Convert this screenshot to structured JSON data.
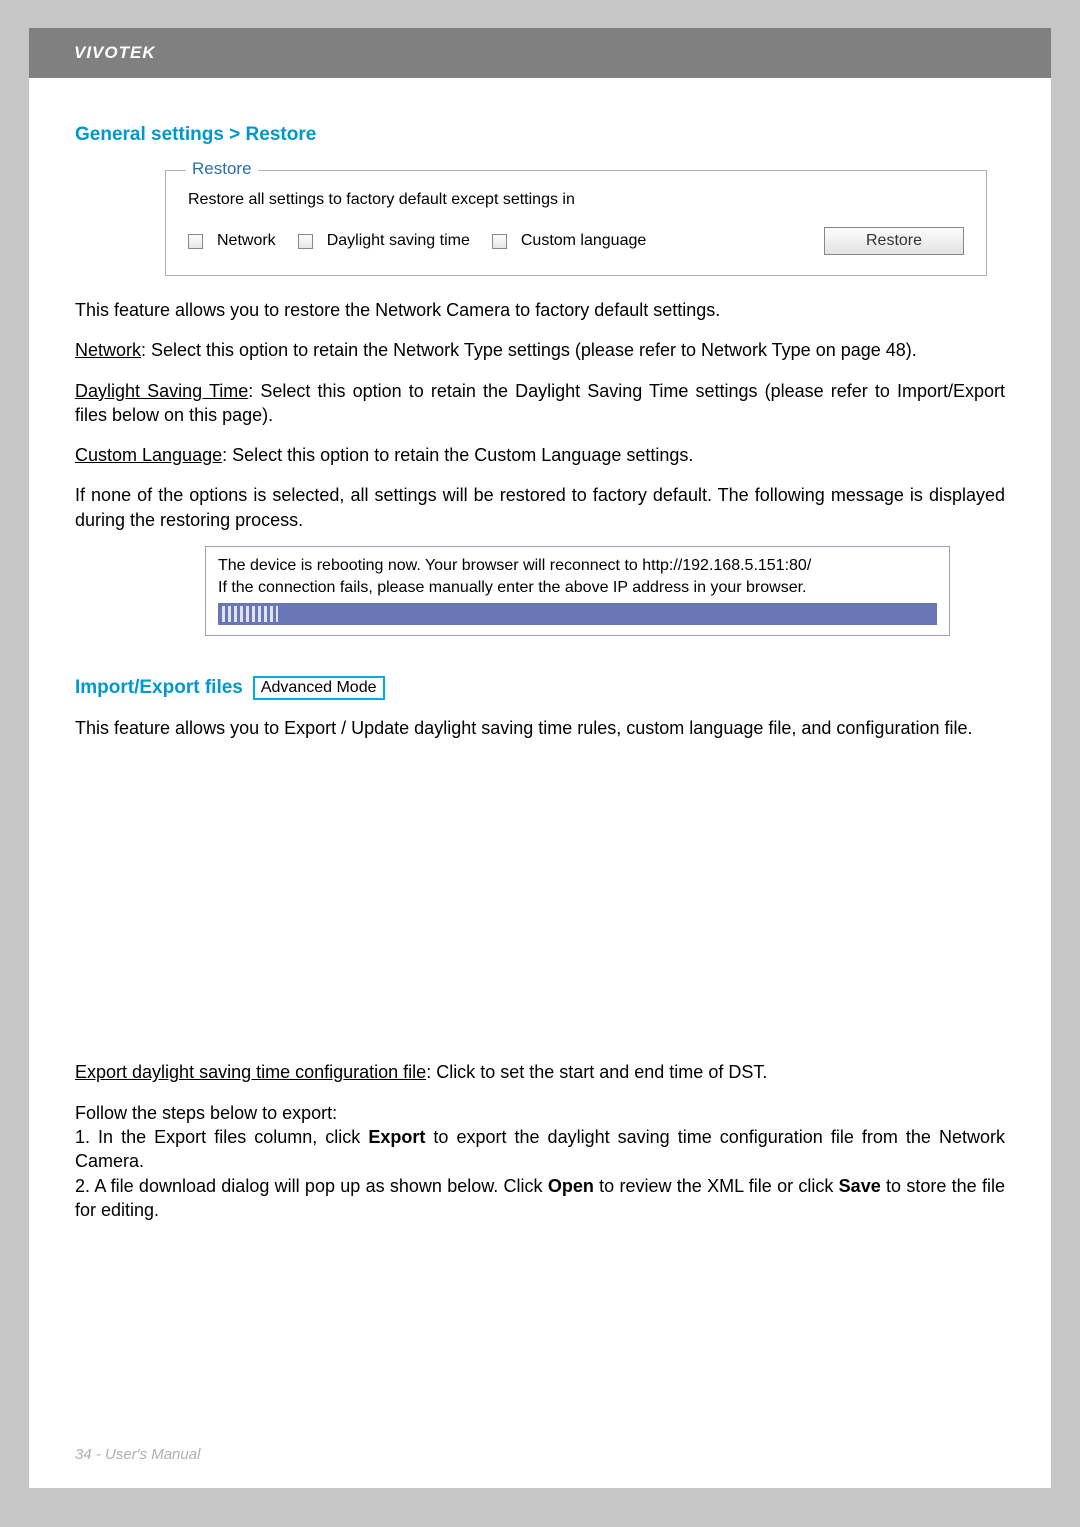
{
  "header": {
    "brand": "VIVOTEK"
  },
  "section1": {
    "title": "General settings > Restore",
    "box": {
      "legend": "Restore",
      "desc": "Restore all settings to factory default except settings in",
      "options": {
        "network": "Network",
        "dst": "Daylight saving time",
        "lang": "Custom language"
      },
      "button": "Restore"
    },
    "intro": "This feature allows you to restore the Network Camera to factory default settings.",
    "network_label": "Network",
    "network_text": ": Select this option to retain the Network Type settings (please refer to Network Type on page 48).",
    "dst_label": "Daylight Saving Time",
    "dst_text": ": Select this option to retain the Daylight Saving Time settings (please refer to Import/Export files below on this page).",
    "lang_label": "Custom Language",
    "lang_text": ": Select this option to retain the Custom Language settings.",
    "none_text": "If none of the options is selected, all settings will be restored to factory default.  The following message is displayed during the restoring process.",
    "reboot_line1": "The device is rebooting now. Your browser will reconnect to http://192.168.5.151:80/",
    "reboot_line2": "If the connection fails, please manually enter the above IP address in your browser."
  },
  "section2": {
    "title": "Import/Export files",
    "badge": "Advanced Mode",
    "intro": "This feature allows you to Export / Update daylight saving time rules, custom language file, and configuration file.",
    "export_label": "Export daylight saving time configuration file",
    "export_text": ": Click to set the start and end time of DST.",
    "steps_intro": "Follow the steps below to export:",
    "step1_pre": "1. In the Export files column, click ",
    "step1_bold": "Export",
    "step1_post": " to export the daylight saving time configuration file from the Network Camera.",
    "step2_pre": "2. A file download dialog will pop up as shown below. Click ",
    "step2_bold1": "Open",
    "step2_mid": " to review the XML file or click ",
    "step2_bold2": "Save",
    "step2_post": " to store the file for editing."
  },
  "footer": {
    "text": "34 - User's Manual"
  }
}
